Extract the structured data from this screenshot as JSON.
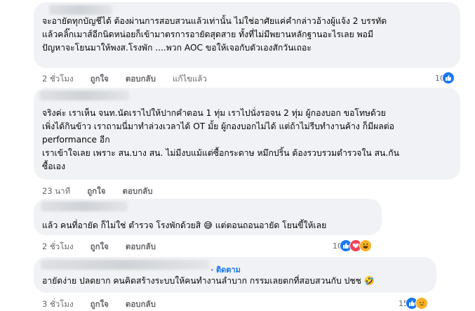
{
  "comments": [
    {
      "text": "จะอายัดทุกบัญชีได้ ต้องผ่านการสอบสวนแล้วเท่านั้น ไม่ใช่อาศัยแค่คำกล่าวอ้างผู้แจ้ง 2 บรรทัด\nแล้วคลิ๊กเมาส์อีกนิดหน่อยก็เข้ามาตรการอายัดสุดสาย ทั้งที่ไม่มีพยานหลักฐานอะไรเลย พอมี\nปัญหาจะโยนมาให้พงส.โรงพัก ....พวก AOC ขอให้เจอกับตัวเองสักวันเถอะ",
      "time": "2 ชั่วโมง",
      "like": "ถูกใจ",
      "reply": "ตอบกลับ",
      "edited": "แก้ไขแล้ว",
      "reaction_count": "10",
      "reactions": [
        "like"
      ]
    },
    {
      "text": "จริงค่ะ เราเห็น จนท.นัดเราไปให้ปากคำตอน 1 ทุ่ม เราไปนั่งรอจน 2 ทุ่ม ผู้กองบอก ขอโทษด้วย\nเพิ่งได้กินข้าว เราถามนี่มาทำล่วงเวลาได้ OT มั้ย ผู้กองบอกไม่ได้ แต่ถ้าไม่รีบทำงานค้าง ก็มีผลต่อ\nperformance อีก\nเราเข้าใจเลย เพราะ สน.บาง สน. ไม่มีงบแม้แต่ซื้อกระดาษ หมึกปริ้น ต้องรวบรวมตำรวจใน สน.กัน\nซื้อเอง",
      "time": "23 นาที",
      "like": "ถูกใจ",
      "reply": "ตอบกลับ"
    },
    {
      "text": "แล้ว คนที่อายัด ก็ไม่ใช่ ตำรวจ โรงพักด้วยสิ 😅 แต่ตอนถอนอายัด โยนขี้ให้เลย",
      "time": "2 ชั่วโมง",
      "like": "ถูกใจ",
      "reply": "ตอบกลับ",
      "reaction_count": "10",
      "reactions": [
        "like",
        "love",
        "haha"
      ]
    },
    {
      "follow": "· ติดตาม",
      "text": "อายัดง่าย ปลดยาก คนคิดสร้างระบบให้คนทำงานลำบาก กรรมเลยตกที่สอบสวนกับ ปชช 🤣",
      "time": "3 ชั่วโมง",
      "like": "ถูกใจ",
      "reply": "ตอบกลับ",
      "reaction_count": "15",
      "reactions": [
        "like",
        "sad"
      ]
    }
  ],
  "icons": {
    "like": "thumbs-up-icon",
    "love": "heart-icon",
    "haha": "laughing-face-icon",
    "sad": "crying-face-icon"
  }
}
